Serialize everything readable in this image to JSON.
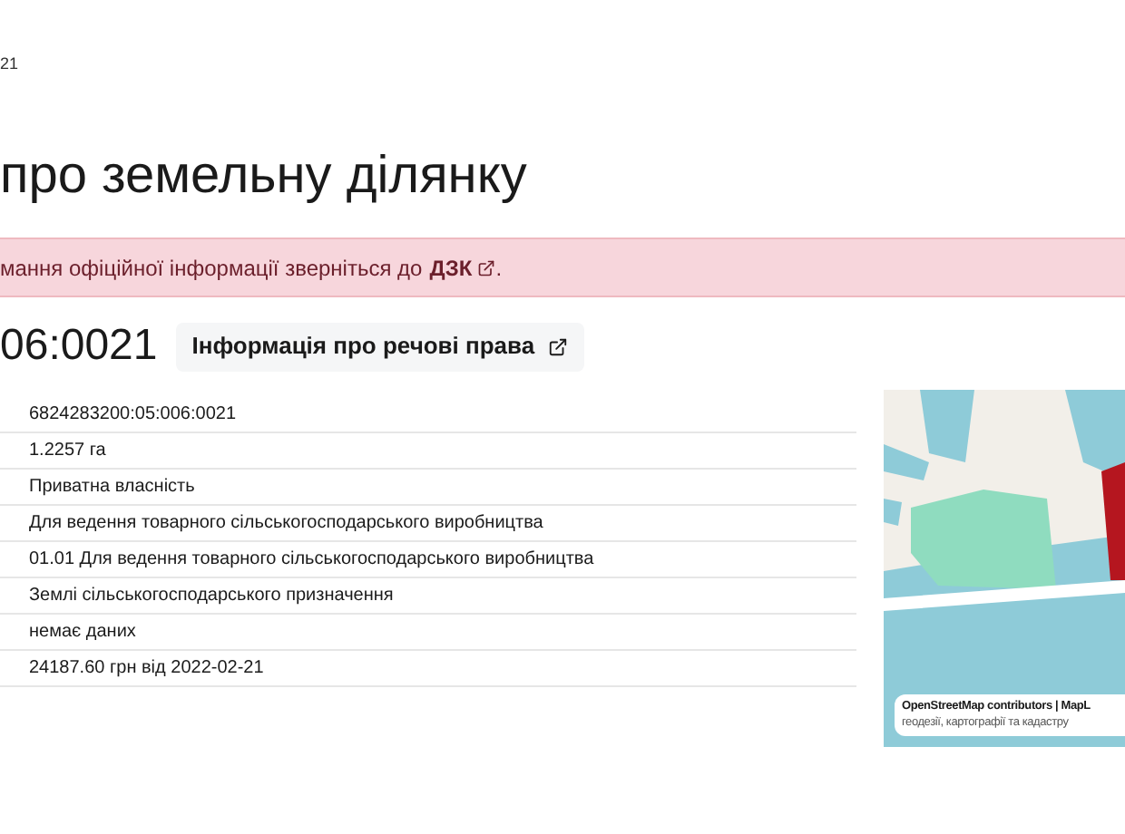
{
  "breadcrumb": "21",
  "title": "про земельну ділянку",
  "alert": {
    "text": "мання офіційної інформації зверніться до",
    "link": "ДЗК",
    "end": "."
  },
  "cadastral_number": "06:0021",
  "rights_button": "Інформація про речові права",
  "rows": [
    {
      "value": "6824283200:05:006:0021"
    },
    {
      "value": "1.2257 га"
    },
    {
      "value": "Приватна власність"
    },
    {
      "value": "Для ведення товарного сільськогосподарського виробництва"
    },
    {
      "value": "01.01 Для ведення товарного сільськогосподарського виробництва"
    },
    {
      "value": "Землі сільськогосподарського призначення"
    },
    {
      "value": "немає даних"
    },
    {
      "value": "24187.60 грн від 2022-02-21"
    }
  ],
  "map": {
    "attribution": "OpenStreetMap contributors | MapL",
    "attribution_2": "геодезії, картографії та кадастру"
  }
}
